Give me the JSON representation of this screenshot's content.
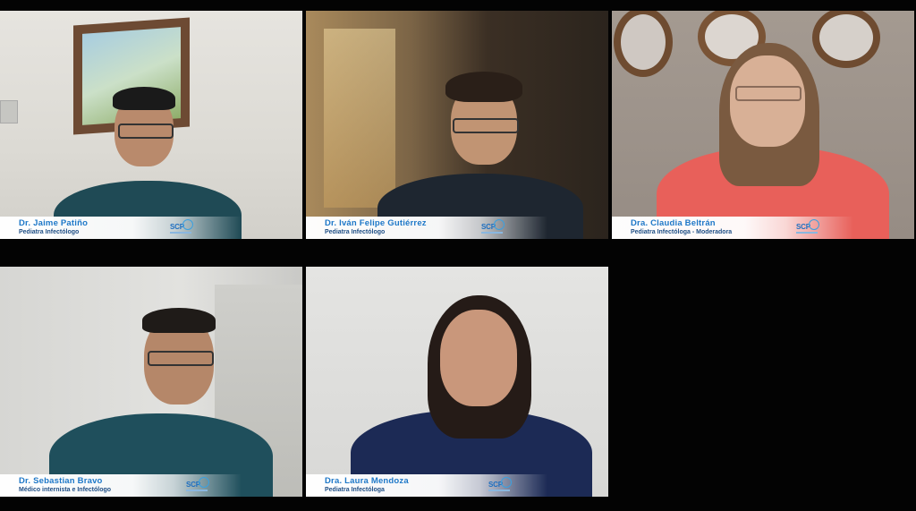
{
  "participants": [
    {
      "name": "Dr. Jaime Patiño",
      "role": "Pediatra Infectólogo",
      "logo": "SCP"
    },
    {
      "name": "Dr. Iván Felipe Gutiérrez",
      "role": "Pediatra Infectólogo",
      "logo": "SCP"
    },
    {
      "name": "Dra. Claudia Beltrán",
      "role": "Pediatra Infectóloga - Moderadora",
      "logo": "SCP"
    },
    {
      "name": "Dr. Sebastian Bravo",
      "role": "Médico internista e Infectólogo",
      "logo": "SCP"
    },
    {
      "name": "Dra. Laura Mendoza",
      "role": "Pediatra Infectóloga",
      "logo": "SCP"
    }
  ],
  "colors": {
    "background": "#030303",
    "name_blue": "#1e78c8",
    "role_navy": "#1f4f86"
  }
}
